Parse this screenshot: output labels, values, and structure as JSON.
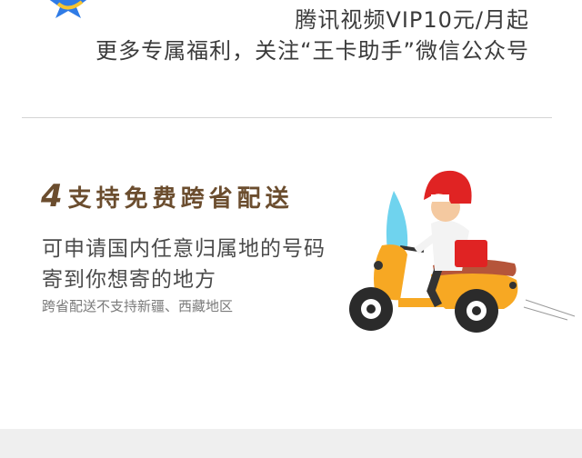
{
  "promo": {
    "line1": "腾讯视频VIP10元/月起",
    "line2": "更多专属福利，关注“王卡助手”微信公众号"
  },
  "feature": {
    "number": "4",
    "title": "支持免费跨省配送",
    "desc_line1": "可申请国内任意归属地的号码",
    "desc_line2": "寄到你想寄的地方",
    "note": "跨省配送不支持新疆、西藏地区"
  },
  "icons": {
    "logo": "star-logo-icon",
    "illustration": "delivery-scooter-icon"
  },
  "colors": {
    "title_brown": "#6b4d2e",
    "rider_red": "#e02323",
    "scooter_orange": "#f7a823"
  }
}
